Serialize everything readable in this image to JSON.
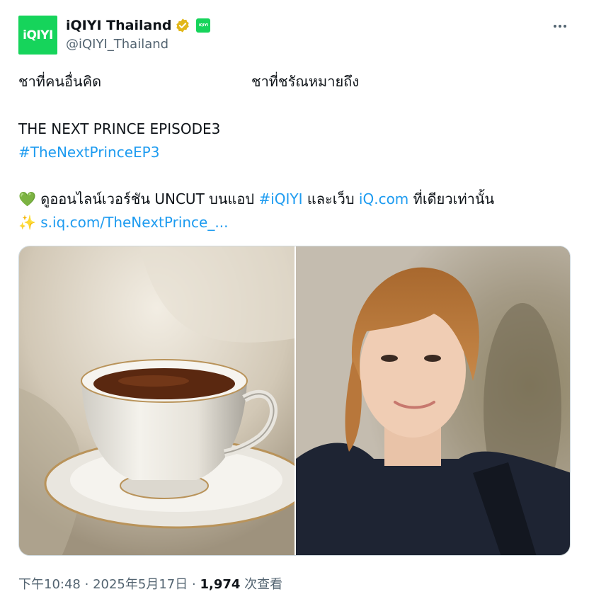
{
  "author": {
    "avatar_text": "iQIYI",
    "display_name": "iQIYI Thailand",
    "handle": "@iQIYI_Thailand",
    "badge_text": "iQIYI",
    "brand_color": "#16d45b",
    "verified_color": "#e2b719"
  },
  "tweet": {
    "line_left": "ชาที่คนอื่นคิด",
    "line_right": "ชาที่ชรัณหมายถึง",
    "title": "THE NEXT PRINCE EPISODE3",
    "hashtag": "#TheNextPrinceEP3",
    "watch_emoji": "💚",
    "watch_text_1": "ดูออนไลน์เวอร์ชัน UNCUT บนแอป",
    "watch_hashtag": "#iQIYI",
    "watch_text_2": "และเว็บ",
    "watch_site": "iQ.com",
    "watch_text_3": "ที่เดียวเท่านั้น",
    "link_emoji": "✨",
    "link_text": "s.iq.com/TheNextPrince_..."
  },
  "media": {
    "left_image": "teacup-photo",
    "right_image": "actor-portrait"
  },
  "footer": {
    "time": "下午10:48",
    "separator": "·",
    "date": "2025年5月17日",
    "views_count": "1,974",
    "views_label": "次查看"
  }
}
